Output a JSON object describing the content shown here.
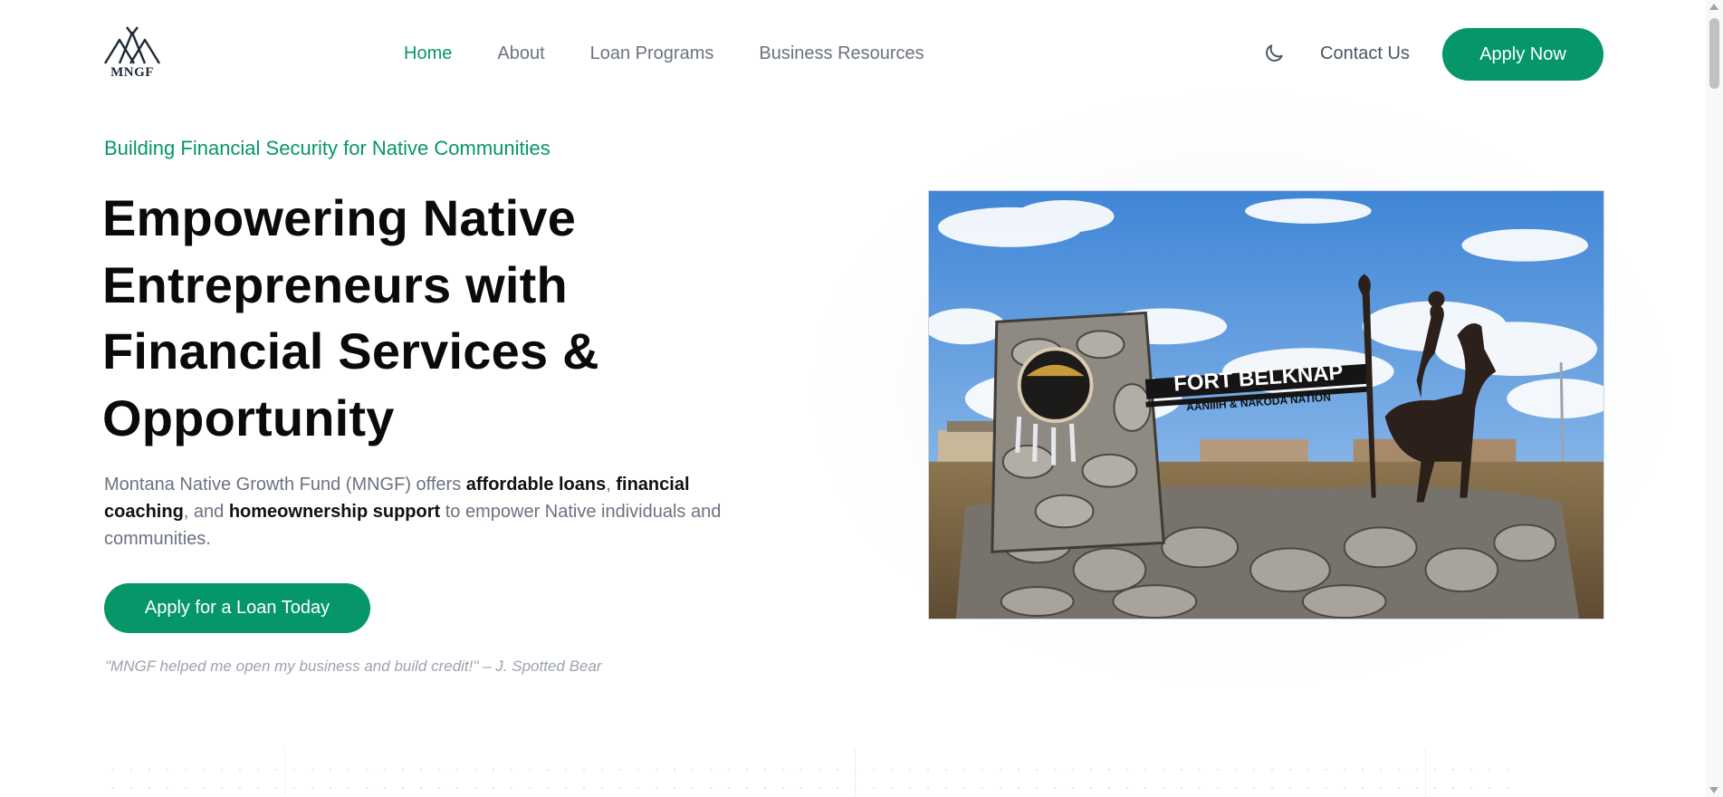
{
  "brand": {
    "logo_text": "MNGF",
    "accent_color": "#059669"
  },
  "nav": {
    "items": [
      {
        "label": "Home",
        "active": true
      },
      {
        "label": "About",
        "active": false
      },
      {
        "label": "Loan Programs",
        "active": false
      },
      {
        "label": "Business Resources",
        "active": false
      }
    ],
    "theme_toggle_icon": "moon-icon",
    "contact_label": "Contact Us",
    "apply_label": "Apply Now"
  },
  "hero": {
    "eyebrow": "Building Financial Security for Native Communities",
    "headline_lines": [
      "Empowering Native",
      "Entrepreneurs with",
      "Financial Services &",
      "Opportunity"
    ],
    "lead": {
      "part1": "Montana Native Growth Fund (MNGF) offers ",
      "bold1": "affordable loans",
      "part2": ", ",
      "bold2": "financial coaching",
      "part3": ", and ",
      "bold3": "homeownership support",
      "part4": " to empower Native individuals and communities."
    },
    "cta_label": "Apply for a Loan Today",
    "testimonial": "\"MNGF helped me open my business and build credit!\" – J. Spotted Bear"
  },
  "image": {
    "sign_title": "FORT BELKNAP",
    "sign_subtitle": "AANIIIH & NAKODA NATION"
  }
}
